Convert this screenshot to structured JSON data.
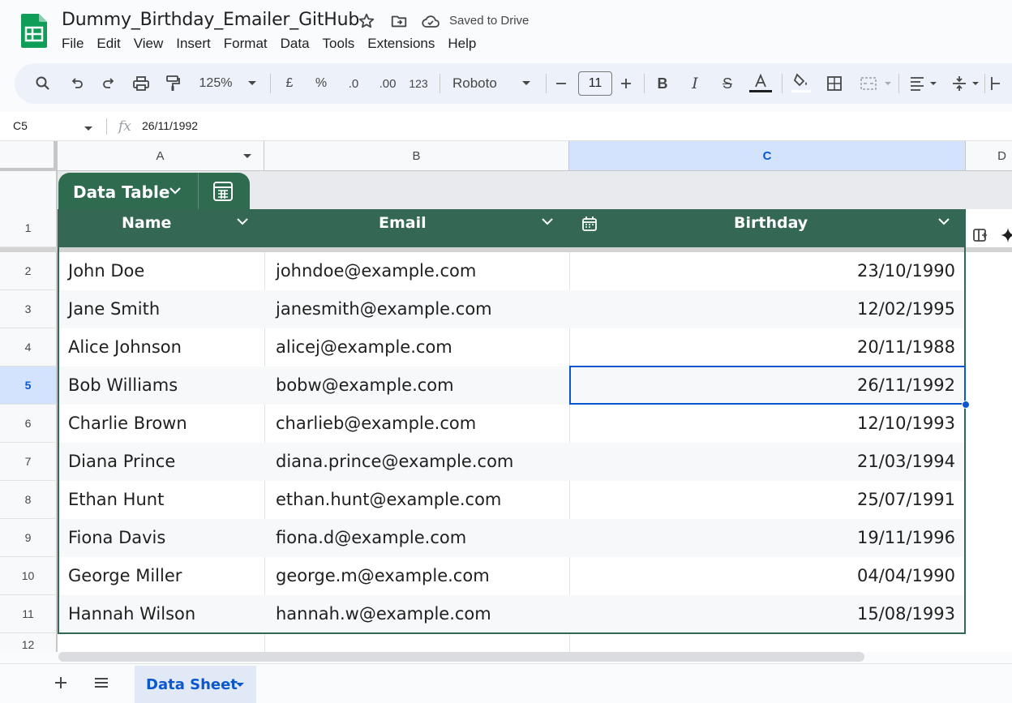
{
  "header": {
    "doc_title": "Dummy_Birthday_Emailer_GitHub",
    "saved_status": "Saved to Drive"
  },
  "menu": [
    "File",
    "Edit",
    "View",
    "Insert",
    "Format",
    "Data",
    "Tools",
    "Extensions",
    "Help"
  ],
  "toolbar": {
    "zoom": "125%",
    "currency": "£",
    "percent": "%",
    "decimal_decrease": ".0",
    "decimal_increase": ".00",
    "number_format": "123",
    "font": "Roboto",
    "font_size": "11"
  },
  "formula_bar": {
    "name_box": "C5",
    "fx": "fx",
    "formula": "26/11/1992"
  },
  "columns": [
    "A",
    "B",
    "C",
    "D"
  ],
  "selected_column": "C",
  "selected_row": "5",
  "table": {
    "tab_label": "Data Table",
    "headers": [
      "Name",
      "Email",
      "Birthday"
    ],
    "rows": [
      {
        "row": "2",
        "name": "John Doe",
        "email": "johndoe@example.com",
        "birthday": "23/10/1990"
      },
      {
        "row": "3",
        "name": "Jane Smith",
        "email": "janesmith@example.com",
        "birthday": "12/02/1995"
      },
      {
        "row": "4",
        "name": "Alice Johnson",
        "email": "alicej@example.com",
        "birthday": "20/11/1988"
      },
      {
        "row": "5",
        "name": "Bob Williams",
        "email": "bobw@example.com",
        "birthday": "26/11/1992"
      },
      {
        "row": "6",
        "name": "Charlie Brown",
        "email": "charlieb@example.com",
        "birthday": "12/10/1993"
      },
      {
        "row": "7",
        "name": "Diana Prince",
        "email": "diana.prince@example.com",
        "birthday": "21/03/1994"
      },
      {
        "row": "8",
        "name": "Ethan Hunt",
        "email": "ethan.hunt@example.com",
        "birthday": "25/07/1991"
      },
      {
        "row": "9",
        "name": "Fiona Davis",
        "email": "fiona.d@example.com",
        "birthday": "19/11/1996"
      },
      {
        "row": "10",
        "name": "George Miller",
        "email": "george.m@example.com",
        "birthday": "04/04/1990"
      },
      {
        "row": "11",
        "name": "Hannah Wilson",
        "email": "hannah.w@example.com",
        "birthday": "15/08/1993"
      }
    ]
  },
  "row_numbers": [
    "1",
    "12"
  ],
  "sheets": [
    {
      "name": "Data Sheet",
      "active": true
    }
  ],
  "colors": {
    "table_header": "#356854",
    "selection": "#0b57d0",
    "sheets_green": "#0f9d58"
  }
}
